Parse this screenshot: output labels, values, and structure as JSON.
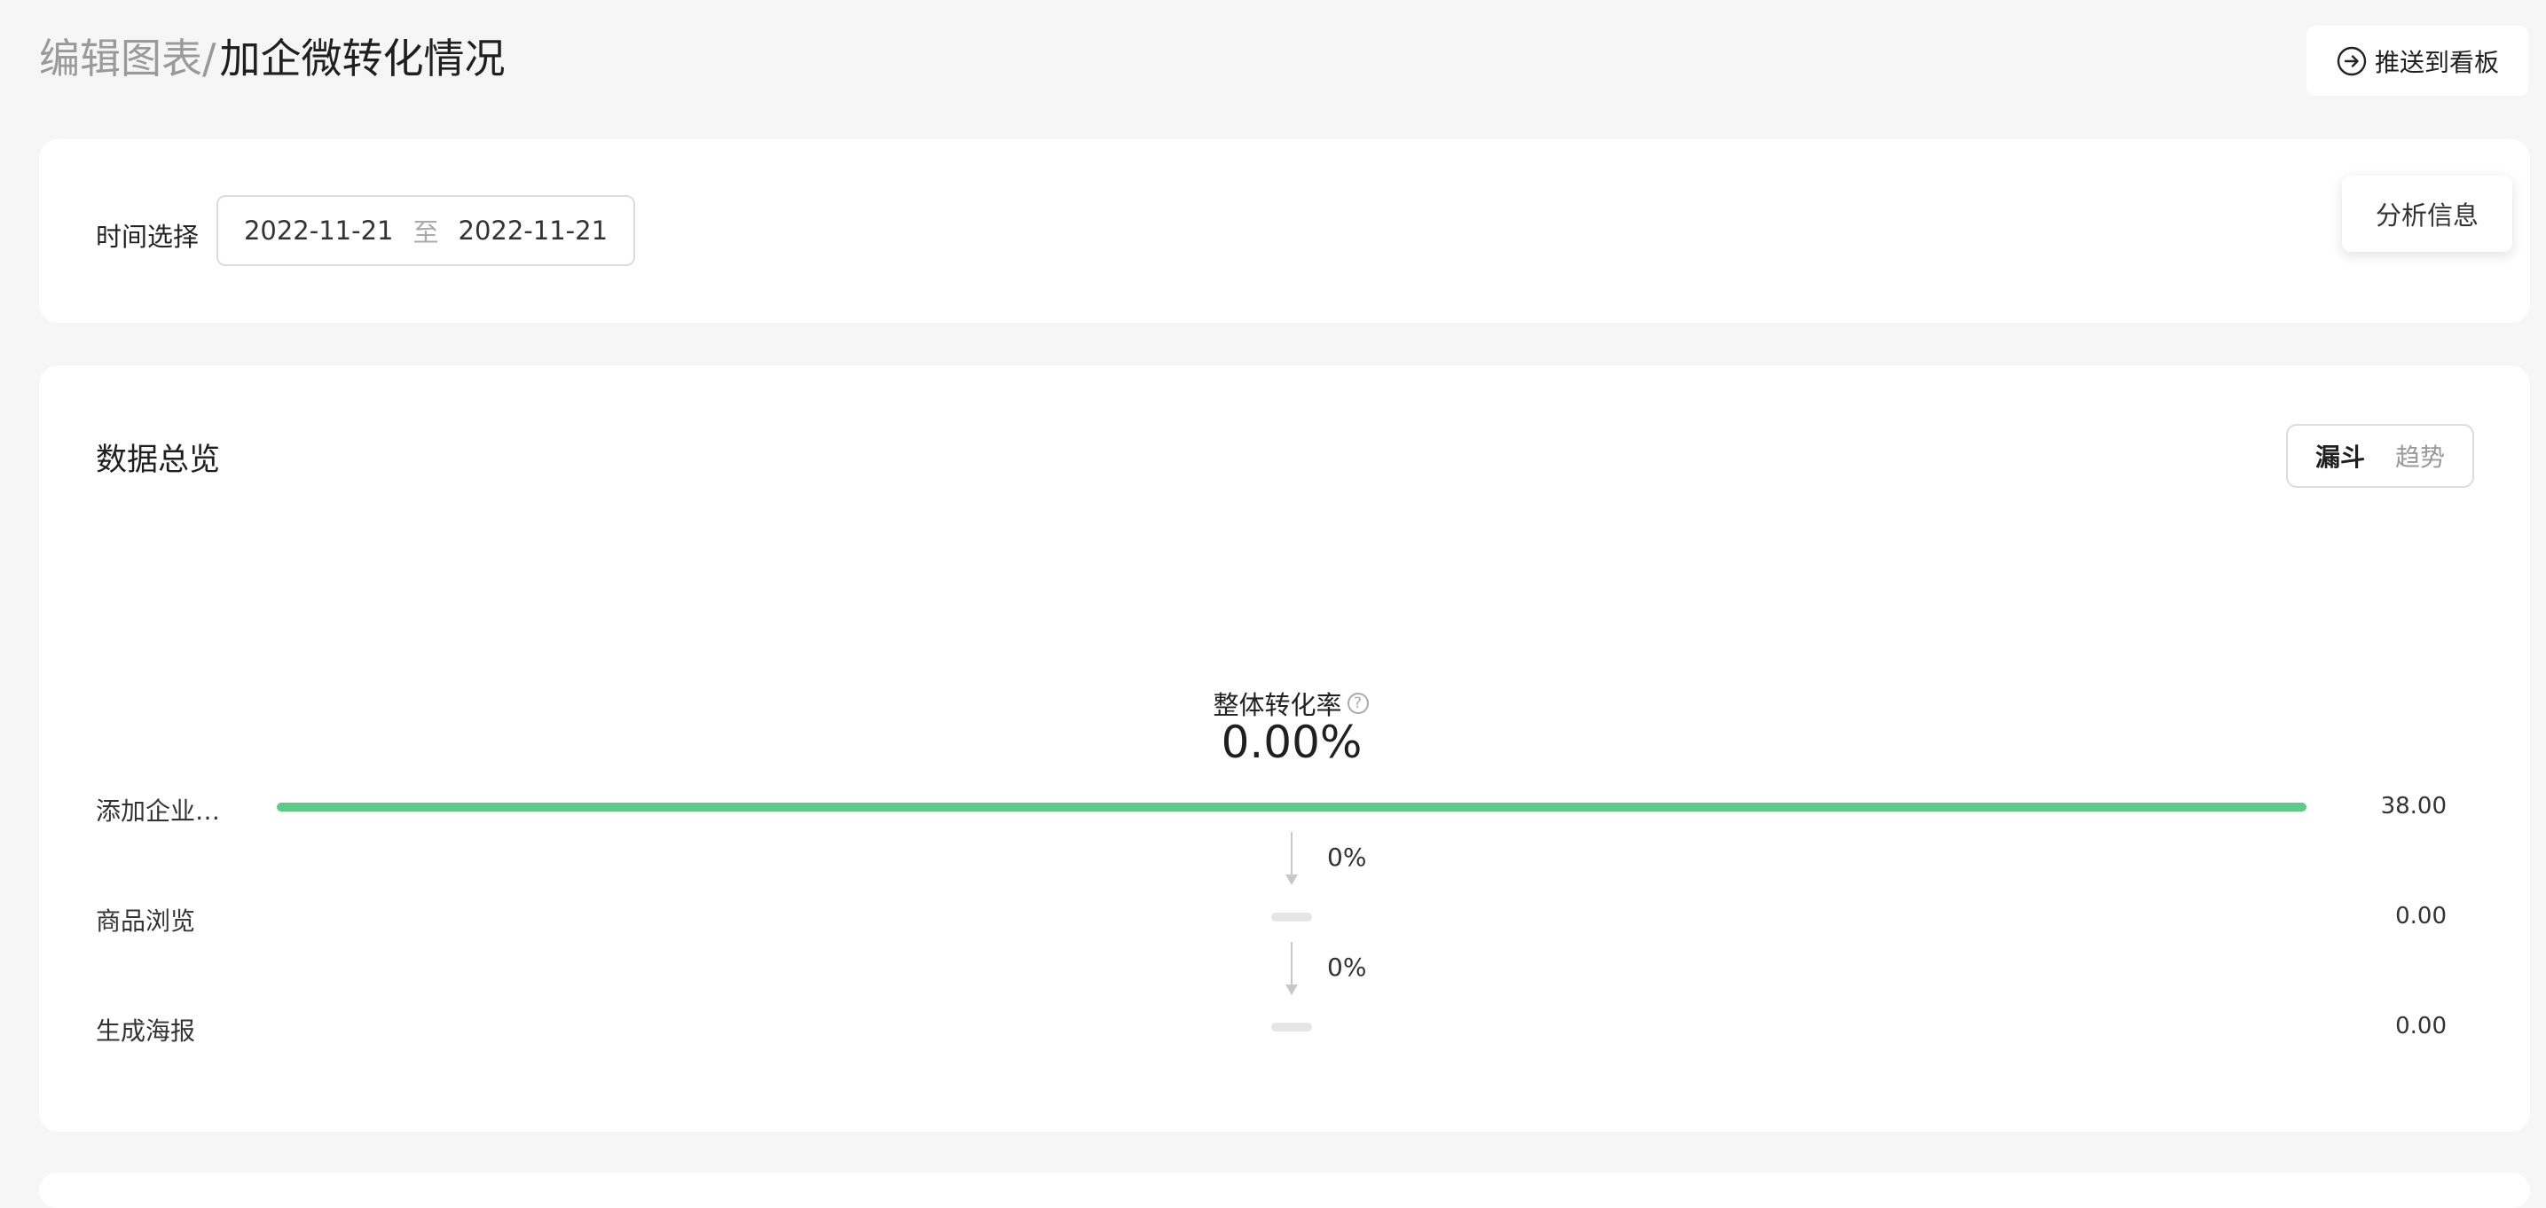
{
  "header": {
    "title_prefix": "编辑图表/",
    "title": "加企微转化情况",
    "push_button_label": "推送到看板"
  },
  "filter": {
    "time_label": "时间选择",
    "start_date": "2022-11-21",
    "separator": "至",
    "end_date": "2022-11-21",
    "analysis_button_label": "分析信息"
  },
  "overview": {
    "section_title": "数据总览",
    "view_toggle": {
      "funnel_label": "漏斗",
      "trend_label": "趋势",
      "selected": "漏斗"
    },
    "overall_conversion": {
      "label": "整体转化率",
      "help_icon": "?",
      "value": "0.00%"
    }
  },
  "chart_data": {
    "type": "bar",
    "categories": [
      "添加企业…",
      "商品浏览",
      "生成海报"
    ],
    "values": [
      38.0,
      0.0,
      0.0
    ],
    "value_labels": [
      "38.00",
      "0.00",
      "0.00"
    ],
    "step_rates": [
      "0%",
      "0%"
    ],
    "colors": {
      "bar": "#5ccb85",
      "empty": "#e6e6e6"
    }
  }
}
